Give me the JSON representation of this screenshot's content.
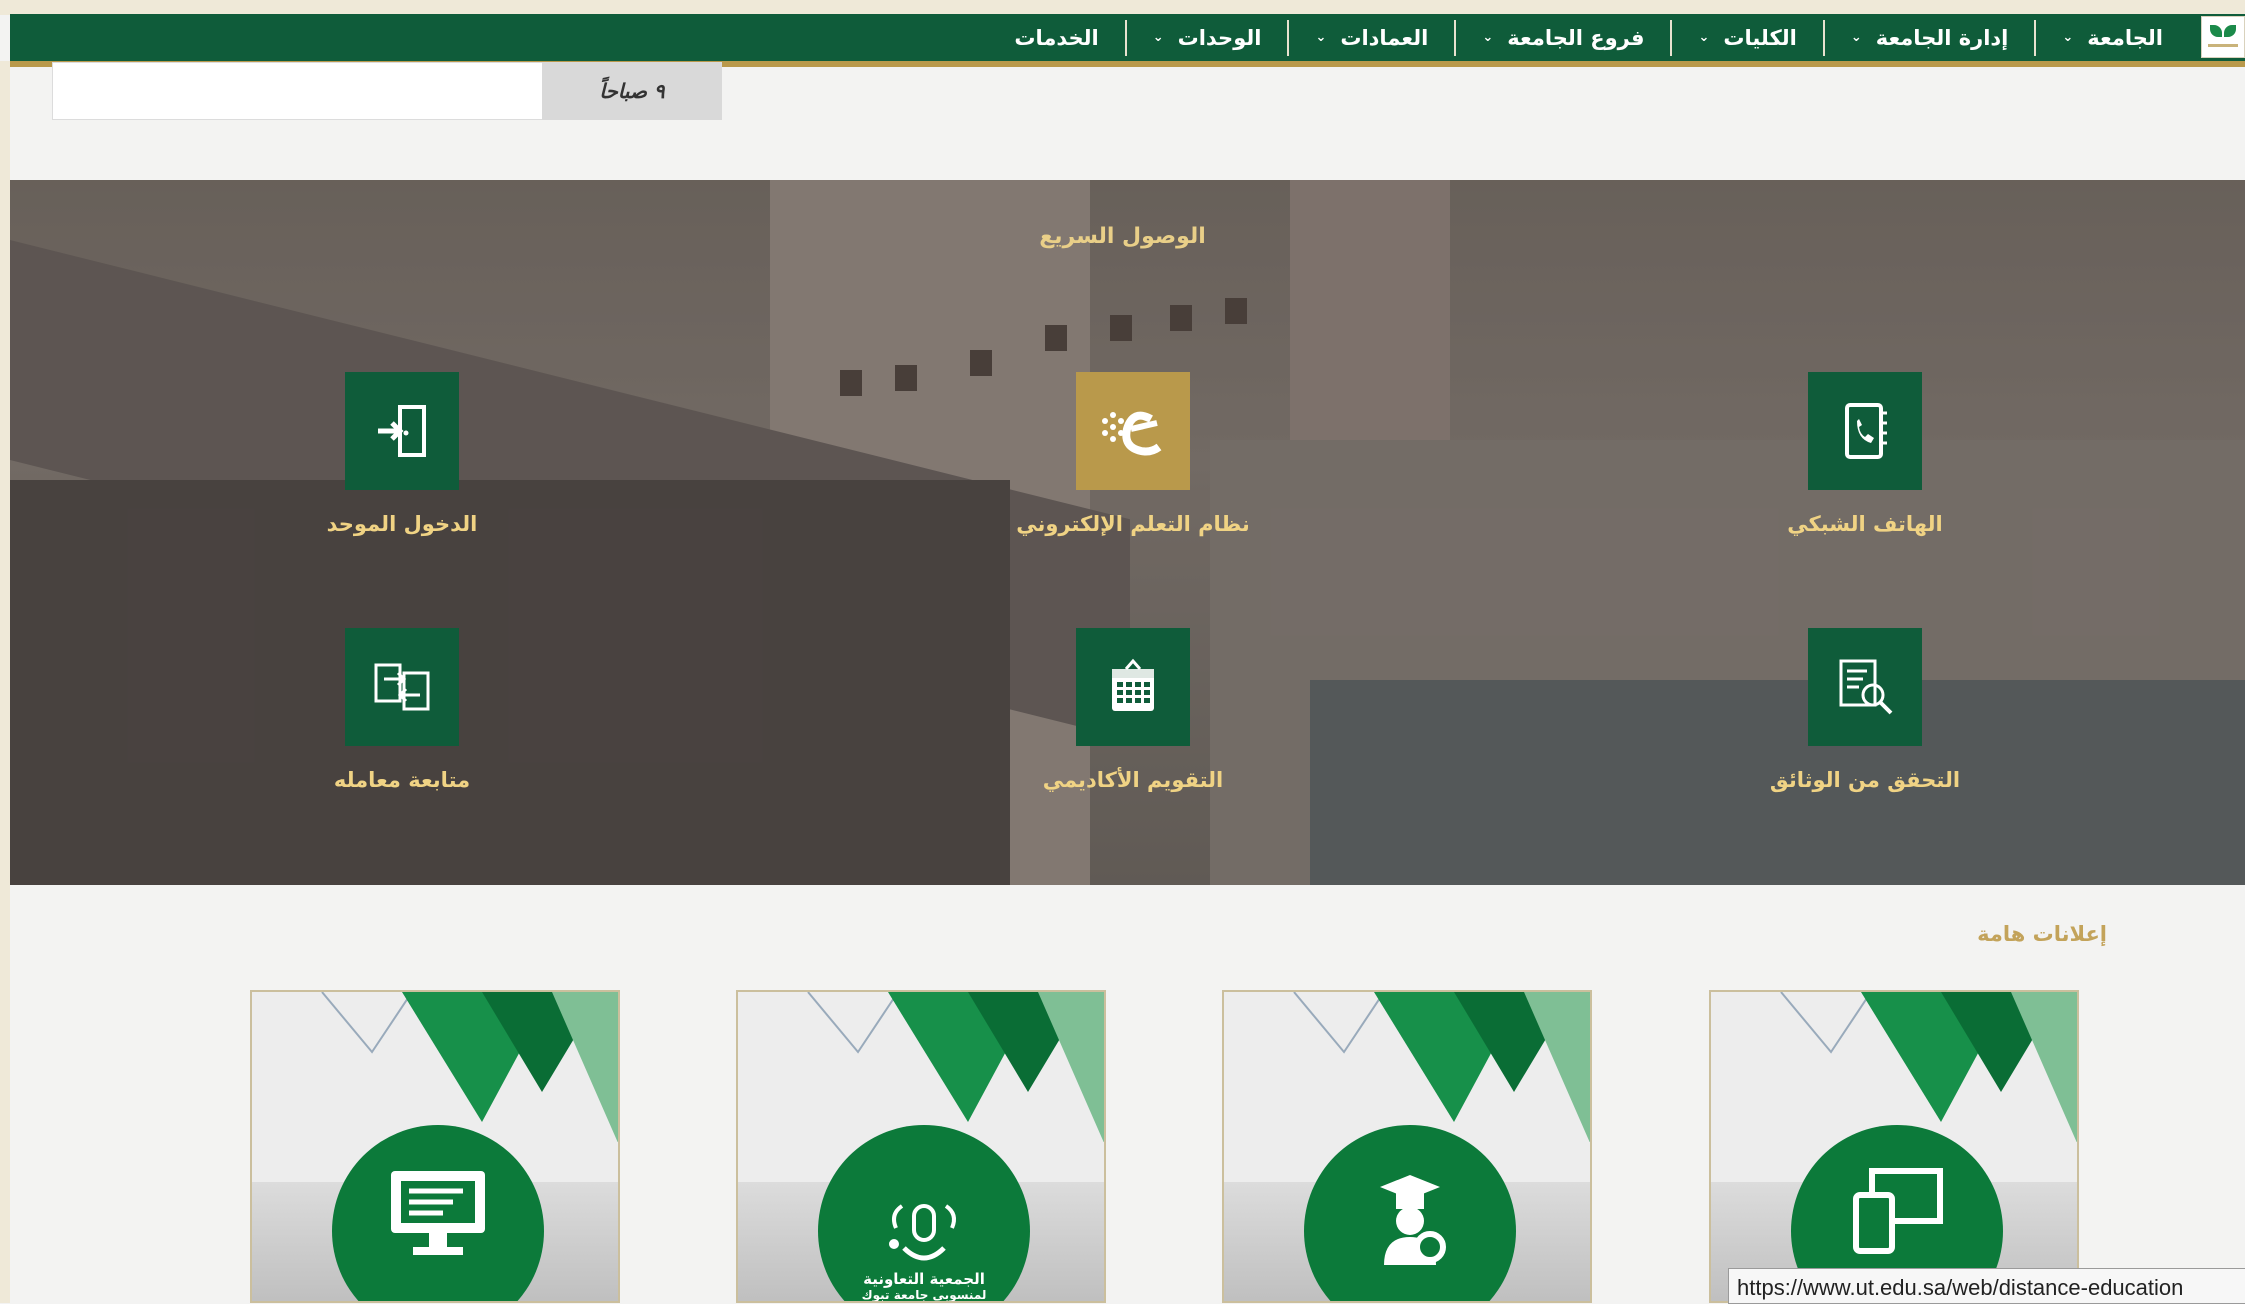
{
  "nav": {
    "items": [
      {
        "label": "الجامعة",
        "has_dropdown": true
      },
      {
        "label": "إدارة الجامعة",
        "has_dropdown": true
      },
      {
        "label": "الكليات",
        "has_dropdown": true
      },
      {
        "label": "فروع الجامعة",
        "has_dropdown": true
      },
      {
        "label": "العمادات",
        "has_dropdown": true
      },
      {
        "label": "الوحدات",
        "has_dropdown": true
      },
      {
        "label": "الخدمات",
        "has_dropdown": false
      }
    ]
  },
  "time_widget": {
    "label": "٩ صباحاً"
  },
  "quick_access": {
    "title": "الوصول السريع",
    "tiles": [
      {
        "label": "الهاتف الشبكي",
        "icon": "phone-book-icon"
      },
      {
        "label": "نظام التعلم الإلكتروني",
        "icon": "elearning-icon"
      },
      {
        "label": "الدخول الموحد",
        "icon": "login-door-icon"
      },
      {
        "label": "التحقق من الوثائق",
        "icon": "document-search-icon"
      },
      {
        "label": "التقويم الأكاديمي",
        "icon": "calendar-icon"
      },
      {
        "label": "متابعة معامله",
        "icon": "transfer-icon"
      }
    ]
  },
  "announcements": {
    "title": "إعلانات هامة",
    "cards": [
      {
        "icon": "devices-icon"
      },
      {
        "icon": "graduate-gear-icon"
      },
      {
        "icon": "cooperative-society-logo",
        "text": "الجمعية التعاونية",
        "subtext": "لمنسوبي جامعة تبوك"
      },
      {
        "icon": "monitor-icon"
      }
    ]
  },
  "status_bar": {
    "url": "https://www.ut.edu.sa/web/distance-education"
  },
  "colors": {
    "primary_green": "#0f5c3a",
    "gold": "#b9994b",
    "label_gold": "#f0d384"
  }
}
